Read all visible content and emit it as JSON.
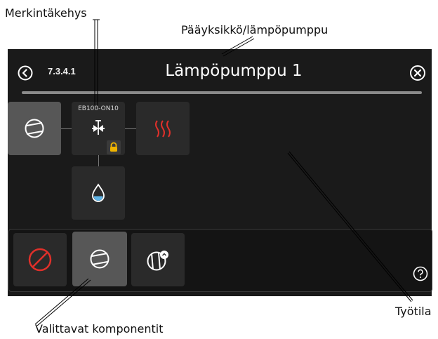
{
  "callouts": {
    "frame_label": "Merkintäkehys",
    "main_unit": "Pääyksikkö/lämpöpumppu",
    "work_area": "Työtila",
    "selectable": "Valittavat komponentit"
  },
  "header": {
    "menu_number": "7.3.4.1",
    "title": "Lämpöpumppu 1"
  },
  "components": {
    "valve_label": "EB100-ON10"
  },
  "colors": {
    "heating_red": "#e0302a",
    "lock_yellow": "#f0b400",
    "water_blue": "#5fb4e6",
    "block_red": "#e0302a"
  },
  "icons": [
    "back-icon",
    "close-icon",
    "compressor-icon",
    "expansion-valve-icon",
    "lock-icon",
    "heat-icon",
    "water-drop-icon",
    "blocked-icon",
    "compressor-icon",
    "compressor-gauge-icon",
    "help-icon"
  ]
}
